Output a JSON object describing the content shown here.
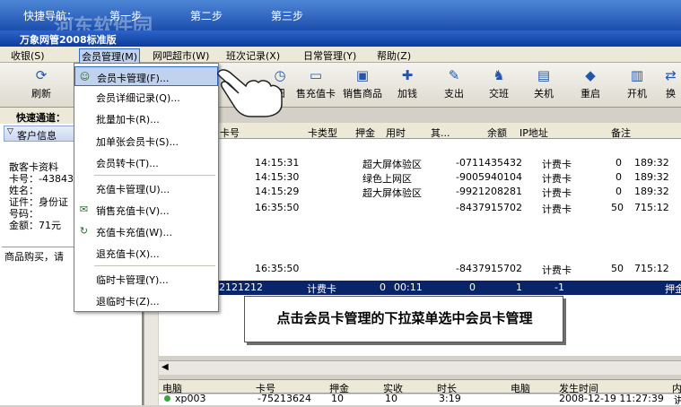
{
  "guide": {
    "label": "快捷导航：",
    "steps": [
      "第一步",
      "第二步",
      "第三步"
    ]
  },
  "window": {
    "title": "万象网管2008标准版"
  },
  "watermark": "河东软件园",
  "menu": [
    "收银(S)",
    "会员管理(M)",
    "网吧超市(W)",
    "班次记录(X)",
    "日常管理(Y)",
    "帮助(Z)"
  ],
  "toolbar": [
    {
      "label": "刷新",
      "icon": "refresh-icon"
    },
    {
      "label": "细",
      "icon": "detail-icon"
    },
    {
      "label": "售充值卡",
      "icon": "card-icon"
    },
    {
      "label": "销售商品",
      "icon": "box-icon"
    },
    {
      "label": "加钱",
      "icon": "add-money-icon"
    },
    {
      "label": "支出",
      "icon": "expense-icon"
    },
    {
      "label": "交班",
      "icon": "shift-icon"
    },
    {
      "label": "关机",
      "icon": "shutdown-icon"
    },
    {
      "label": "重启",
      "icon": "restart-icon"
    },
    {
      "label": "开机",
      "icon": "power-on-icon"
    },
    {
      "label": "换",
      "icon": "swap-icon"
    }
  ],
  "left": {
    "quick": "快速通道：",
    "customer_info": "客户信息",
    "card_lines": [
      "散客卡资料",
      "卡号：-43843",
      "姓名：",
      "证件：身份证",
      "号码：",
      "金额：71元"
    ],
    "buy_bar": "商品购买，请"
  },
  "grid": {
    "headers": [
      "卡号",
      "卡类型",
      "押金",
      "用时",
      "其...",
      "余额",
      "IP地址",
      "备注"
    ],
    "rows": [
      {
        "time": "14:15:31",
        "area": "超大屏体验区",
        "card": "-0711435432",
        "type": "计费卡",
        "n1": "0",
        "n2": "189:32"
      },
      {
        "time": "14:15:30",
        "area": "绿色上网区",
        "card": "-9005940104",
        "type": "计费卡",
        "n1": "0",
        "n2": "189:32"
      },
      {
        "time": "14:15:29",
        "area": "超大屏体验区",
        "card": "-9921208281",
        "type": "计费卡",
        "n1": "0",
        "n2": "189:32"
      },
      {
        "time": "16:35:50",
        "area": "",
        "card": "-8437915702",
        "type": "计费卡",
        "n1": "50",
        "n2": "715:12"
      },
      {
        "time": "16:35:50",
        "area": "",
        "card": "-8437915702",
        "type": "计费卡",
        "n1": "50",
        "n2": "715:12"
      }
    ],
    "selected": {
      "c1": "2121212",
      "c2": "计费卡",
      "c3": "0",
      "c4": "00:11",
      "c5": "0",
      "c6": "1",
      "c7": "-1",
      "c8": "押金"
    }
  },
  "dropdown": [
    {
      "label": "会员卡管理(F)...",
      "icon": "member-icon"
    },
    {
      "label": "会员详细记录(Q)...",
      "icon": ""
    },
    {
      "label": "批量加卡(R)...",
      "icon": ""
    },
    {
      "label": "加单张会员卡(S)...",
      "icon": ""
    },
    {
      "label": "会员转卡(T)...",
      "icon": ""
    },
    {
      "label": "充值卡管理(U)...",
      "icon": ""
    },
    {
      "label": "销售充值卡(V)...",
      "icon": "sell-card-icon"
    },
    {
      "label": "充值卡充值(W)...",
      "icon": "recharge-icon"
    },
    {
      "label": "退充值卡(X)...",
      "icon": ""
    },
    {
      "label": "临时卡管理(Y)...",
      "icon": ""
    },
    {
      "label": "退临时卡(Z)...",
      "icon": ""
    }
  ],
  "callout": "点击会员卡管理的下拉菜单选中会员卡管理",
  "bottom": {
    "headers": [
      "电脑",
      "卡号",
      "押金",
      "实收",
      "时长",
      "电脑",
      "发生时间",
      "内"
    ],
    "row": [
      "xp003",
      "-75213624",
      "10",
      "10",
      "3:19",
      "",
      "2008-12-19 11:27:39",
      "讲"
    ]
  }
}
